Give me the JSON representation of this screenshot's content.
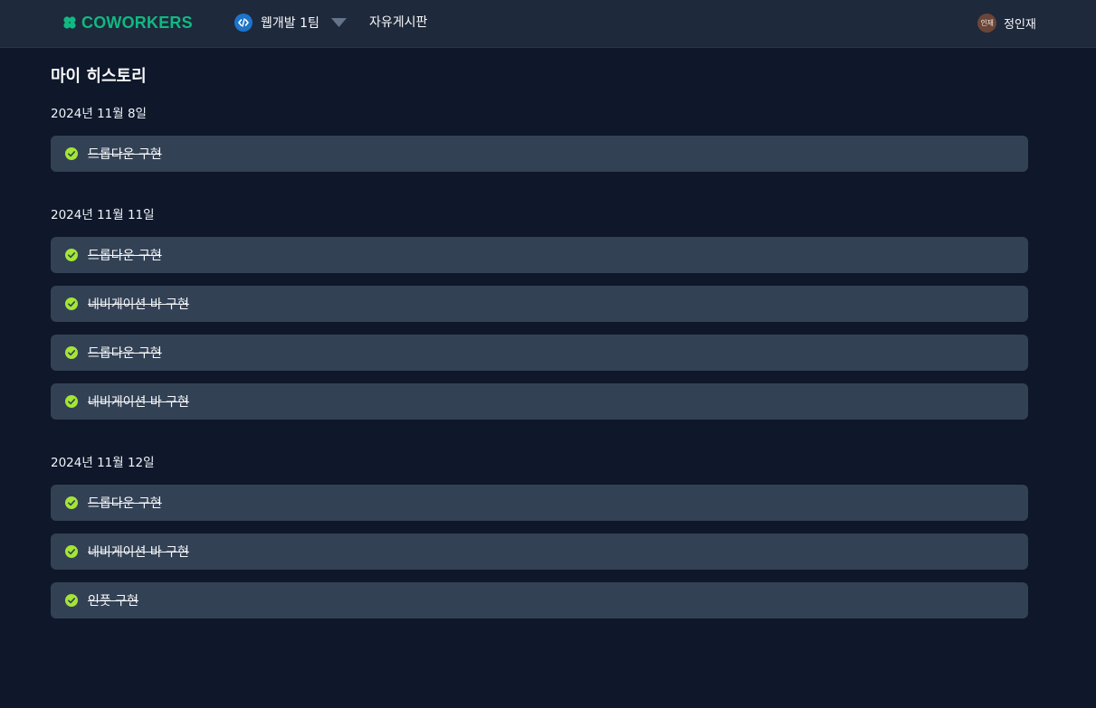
{
  "header": {
    "logo_text": "COWORKERS",
    "team_name": "웹개발 1팀",
    "board_link": "자유게시판",
    "user_avatar": "인재",
    "user_name": "정인재"
  },
  "page": {
    "title": "마이 히스토리"
  },
  "history": [
    {
      "date": "2024년 11월 8일",
      "tasks": [
        {
          "label": "드롭다운 구현",
          "done": true
        }
      ]
    },
    {
      "date": "2024년 11월 11일",
      "tasks": [
        {
          "label": "드롭다운 구현",
          "done": true
        },
        {
          "label": "네비게이션 바 구현",
          "done": true
        },
        {
          "label": "드롭다운 구현",
          "done": true
        },
        {
          "label": "네비게이션 바 구현",
          "done": true
        }
      ]
    },
    {
      "date": "2024년 11월 12일",
      "tasks": [
        {
          "label": "드롭다운 구현",
          "done": true
        },
        {
          "label": "네비게이션 바 구현",
          "done": true
        },
        {
          "label": "인풋 구현",
          "done": true
        }
      ]
    }
  ],
  "icons": {
    "logo": "clover-icon",
    "team": "code-icon",
    "team_dropdown": "caret-down-icon",
    "task_status": "check-circle-icon"
  },
  "colors": {
    "background": "#0f172a",
    "header": "#1e293b",
    "card": "#334155",
    "brand": "#10b981",
    "check": "#a3e635"
  }
}
